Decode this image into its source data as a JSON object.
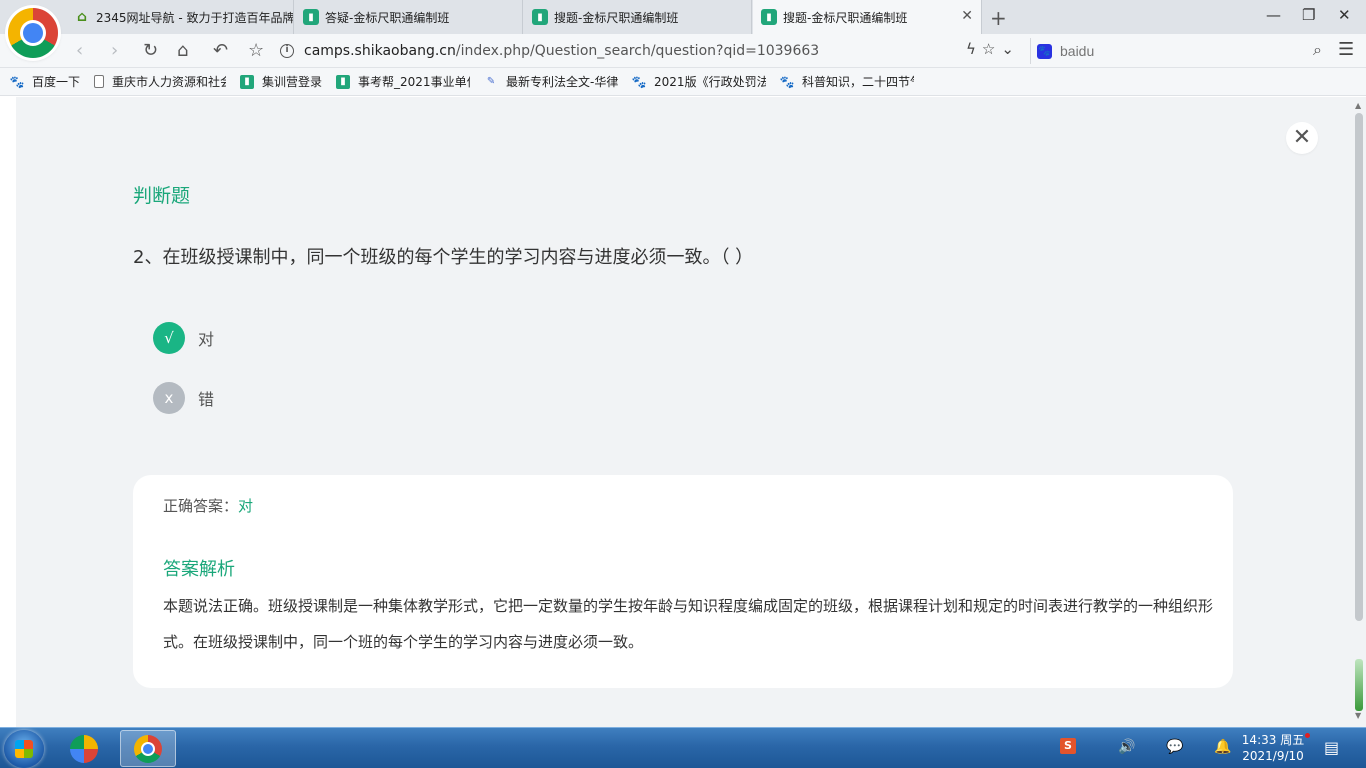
{
  "tabs": [
    {
      "label": "2345网址导航 - 致力于打造百年品牌",
      "icon": "house-icon",
      "active": false
    },
    {
      "label": "答疑-金标尺职通编制班",
      "icon": "book-icon",
      "active": false
    },
    {
      "label": "搜题-金标尺职通编制班",
      "icon": "book-icon",
      "active": false
    },
    {
      "label": "搜题-金标尺职通编制班",
      "icon": "book-icon",
      "active": true
    }
  ],
  "address": {
    "host": "camps.shikaobang.cn",
    "path": "/index.php/Question_search/question?qid=1039663"
  },
  "search": {
    "placeholder": "baidu"
  },
  "bookmarks": [
    {
      "label": "百度一下",
      "icon": "paw-icon"
    },
    {
      "label": "重庆市人力资源和社会",
      "icon": "document-icon"
    },
    {
      "label": "集训营登录",
      "icon": "book-icon"
    },
    {
      "label": "事考帮_2021事业单位",
      "icon": "book-icon"
    },
    {
      "label": "最新专利法全文-华律",
      "icon": "quill-icon"
    },
    {
      "label": "2021版《行政处罚法",
      "icon": "paw-icon"
    },
    {
      "label": "科普知识，二十四节气",
      "icon": "paw-icon"
    }
  ],
  "question": {
    "type": "判断题",
    "text": "2、在班级授课制中，同一个班级的每个学生的学习内容与进度必须一致。（    ）",
    "options": [
      {
        "mark": "√",
        "text": "对",
        "state": "correct"
      },
      {
        "mark": "x",
        "text": "错",
        "state": "wrong"
      }
    ]
  },
  "answer": {
    "label": "正确答案：",
    "value": "对",
    "analysis_title": "答案解析",
    "analysis_text": "本题说法正确。班级授课制是一种集体教学形式，它把一定数量的学生按年龄与知识程度编成固定的班级，根据课程计划和规定的时间表进行教学的一种组织形式。在班级授课制中，同一个班的每个学生的学习内容与进度必须一致。"
  },
  "taskbar": {
    "time": "14:33 周五",
    "date": "2021/9/10"
  },
  "colors": {
    "accent_green": "#1aa77a",
    "correct_badge": "#1ab585",
    "wrong_badge": "#b4bac1"
  }
}
